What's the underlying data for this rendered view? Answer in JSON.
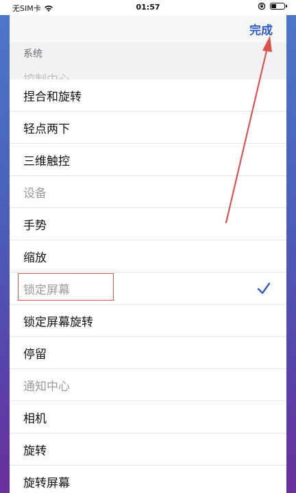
{
  "status_bar": {
    "carrier": "无SIM卡",
    "time": "01:57"
  },
  "nav": {
    "done_label": "完成"
  },
  "section": {
    "title": "系统",
    "cut_off_row": "控制中心"
  },
  "items": [
    {
      "label": "捏合和旋转",
      "state": "enabled"
    },
    {
      "label": "轻点两下",
      "state": "enabled"
    },
    {
      "label": "三维触控",
      "state": "enabled"
    },
    {
      "label": "设备",
      "state": "disabled"
    },
    {
      "label": "手势",
      "state": "enabled"
    },
    {
      "label": "缩放",
      "state": "enabled"
    },
    {
      "label": "锁定屏幕",
      "state": "disabled",
      "selected": true
    },
    {
      "label": "锁定屏幕旋转",
      "state": "enabled"
    },
    {
      "label": "停留",
      "state": "enabled"
    },
    {
      "label": "通知中心",
      "state": "disabled"
    },
    {
      "label": "相机",
      "state": "enabled"
    },
    {
      "label": "旋转",
      "state": "enabled"
    },
    {
      "label": "旋转屏幕",
      "state": "enabled"
    }
  ],
  "colors": {
    "accent": "#2f5cc4",
    "annotation": "#d9534f"
  }
}
